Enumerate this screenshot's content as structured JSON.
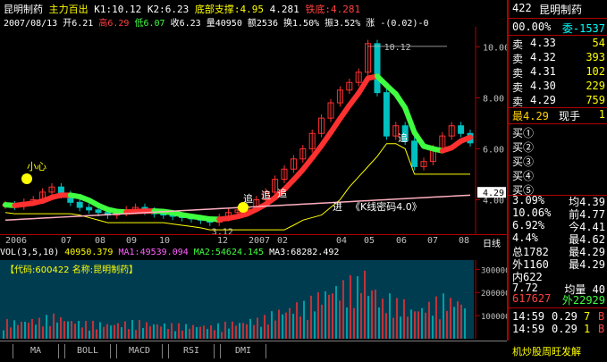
{
  "header": {
    "stock_name": "昆明制药",
    "indicator": "主力百出",
    "k1": "K1:10.12",
    "k2": "K2:6.23",
    "support_label": "底部支撑:",
    "support_value": "4.95",
    "mid_value": "4.281",
    "iron_bottom_label": "铁底:",
    "iron_bottom_value": "4.281",
    "date": "2007/08/13",
    "open": "开6.21",
    "high": "高6.29",
    "low": "低6.07",
    "close": "收6.23",
    "volume": "量40950",
    "amount": "额2536",
    "turnover": "换1.50%",
    "amplitude": "振3.52%",
    "change": "涨 -(0.02)-0"
  },
  "chart_data": {
    "type": "line",
    "y_ticks": [
      "10.00",
      "8.00",
      "6.00",
      "4.00"
    ],
    "ylim": [
      3.0,
      10.5
    ],
    "x_ticks": [
      "2006",
      "07",
      "08",
      "09",
      "10",
      "12",
      "2007",
      "02",
      "04",
      "05",
      "06",
      "07",
      "08"
    ],
    "period_label": "日线",
    "peak_label": "10.12",
    "low_label": "3.12",
    "current_price_label": "4.29",
    "annotations": [
      "小心",
      "追",
      "追",
      "追",
      "进",
      "《K线密码4.0》",
      "追"
    ],
    "price_series": [
      3.8,
      3.75,
      3.9,
      4.0,
      4.3,
      4.5,
      4.2,
      3.9,
      3.7,
      3.6,
      3.5,
      3.4,
      3.5,
      3.6,
      3.7,
      3.55,
      3.45,
      3.4,
      3.35,
      3.3,
      3.25,
      3.2,
      3.12,
      3.3,
      3.5,
      3.6,
      3.7,
      4.0,
      4.3,
      4.8,
      5.2,
      5.6,
      6.0,
      6.6,
      7.2,
      7.8,
      8.3,
      8.6,
      9.0,
      10.12,
      8.2,
      6.5,
      6.9,
      6.3,
      5.3,
      5.5,
      6.0,
      6.5,
      6.9,
      6.6,
      6.23
    ],
    "volume": {
      "label": "VOL(3,5,10)",
      "vol": "40950.379",
      "ma1_label": "MA1:49539.094",
      "ma2_label": "MA2:54624.145",
      "ma3_label": "MA3:68282.492",
      "y_ticks": [
        "300000",
        "200000",
        "100000"
      ],
      "code_text": "【代码:600422 名称:昆明制药】"
    }
  },
  "tabs": [
    "MA",
    "BOLL",
    "MACD",
    "RSI",
    "DMI"
  ],
  "right_panel": {
    "title_code": "422",
    "title_name": "昆明制药",
    "wei_bi": "00.00%",
    "wei_cha": "委-1537",
    "sells": [
      {
        "label": "卖",
        "price": "4.33",
        "vol": "54"
      },
      {
        "label": "卖",
        "price": "4.32",
        "vol": "393"
      },
      {
        "label": "卖",
        "price": "4.31",
        "vol": "102"
      },
      {
        "label": "卖",
        "price": "4.30",
        "vol": "229"
      },
      {
        "label": "卖",
        "price": "4.29",
        "vol": "759"
      }
    ],
    "last_label": "最4.29",
    "hand_label": "现手",
    "hand_value": "1",
    "buys": [
      "买①",
      "买②",
      "买③",
      "买④",
      "买⑤"
    ],
    "stats": [
      {
        "l": "3.09%",
        "r": "均4.39"
      },
      {
        "l": "10.06%",
        "r": "前4.77"
      },
      {
        "l": "6.92%",
        "r": "今4.41"
      },
      {
        "l": "4.4%",
        "r": "最4.62"
      },
      {
        "l": "总1782",
        "r": "最4.29"
      },
      {
        "l": "外1160",
        "r": "最4.29"
      },
      {
        "l": "内622",
        "r": ""
      },
      {
        "l": "7.72",
        "r": "均量 40"
      }
    ],
    "bottom1": "617627",
    "bottom2": "外22929",
    "ticks": [
      {
        "t": "14:59",
        "p": "0.29",
        "v": "7",
        "s": "B"
      },
      {
        "t": "14:59",
        "p": "0.29",
        "v": "1",
        "s": "B"
      }
    ],
    "footer": "机炒股周旺发解"
  },
  "colors": {
    "up": "#ff3030",
    "down": "#40ff40",
    "axis": "#b00000",
    "ma_yellow": "#ffff00",
    "ma_white": "#ffffff",
    "ma_pink": "#ffb0c0",
    "vol_fill": "#003c50"
  }
}
